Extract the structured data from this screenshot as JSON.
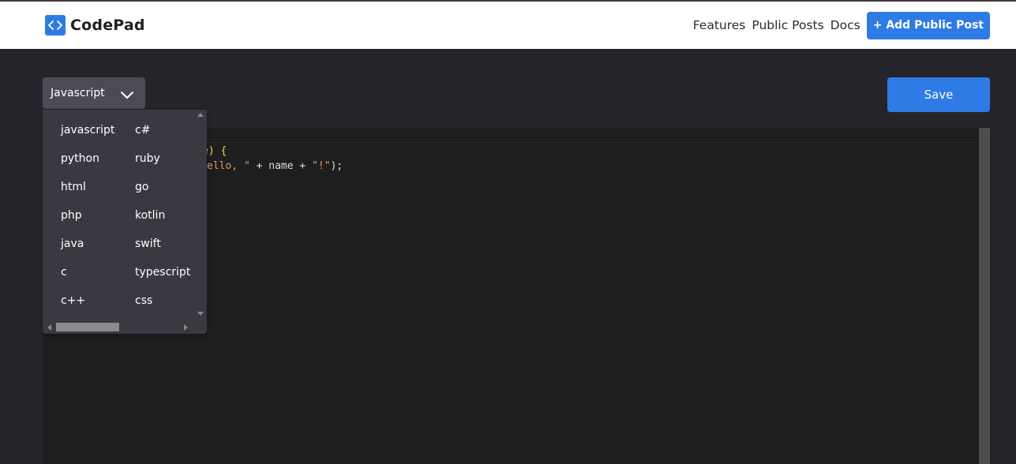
{
  "header": {
    "brand": "CodePad",
    "nav": {
      "features": "Features",
      "public_posts": "Public Posts",
      "docs": "Docs",
      "add_post": "+ Add Public Post"
    }
  },
  "toolbar": {
    "language_selected": "Javascript",
    "save_label": "Save"
  },
  "language_dropdown": {
    "options": [
      "javascript",
      "c#",
      "python",
      "ruby",
      "html",
      "go",
      "php",
      "kotlin",
      "java",
      "swift",
      "c",
      "typescript",
      "c++",
      "css"
    ]
  },
  "editor": {
    "line1": {
      "a": "e) {"
    },
    "line2": {
      "a": "ello, \"",
      "b": " + name + ",
      "c": "\"!\"",
      "d": ");"
    }
  },
  "colors": {
    "accent": "#2f7be5",
    "background": "#26242b",
    "editor_bg": "#1e1e1e",
    "dropdown_bg": "#3a3840"
  }
}
